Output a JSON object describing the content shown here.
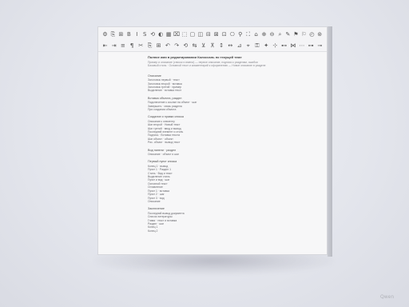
{
  "toolbar": {
    "row1": [
      "⚙",
      "⎘",
      "⊞",
      "B",
      "I",
      "S",
      "⟲",
      "◐",
      "▦",
      "⌧",
      "⬚",
      "▢",
      "◫",
      "⊟",
      "⊠",
      "⊡",
      "⎔",
      "⚲",
      "⛶",
      "⌂",
      "⊕",
      "⊖",
      "⌕",
      "✎",
      "⚑",
      "⚐",
      "◴",
      "⊚"
    ],
    "row2": [
      "⇤",
      "⇥",
      "≡",
      "¶",
      "✂",
      "⎘",
      "⊞",
      "↶",
      "↷",
      "⟲",
      "⇆",
      "⊻",
      "⊼",
      "↕",
      "↔",
      "⊿",
      "⌖",
      "⚿",
      "✦",
      "⊹",
      "⊷",
      "⋈",
      "⋯",
      "⊶",
      "⊸"
    ]
  },
  "document": {
    "title": "Полное имя в редактировании Колоссаль по текущей теме",
    "subtitle1": "Пример и описание (список и имена) — первое описание, подписи к разделам, ошибки",
    "subtitle2": "Базовый стиль · Основной текст и комментарий к оформлению — Новое описание в разделе",
    "sections": [
      {
        "heading": "Описание",
        "lines": [
          "Заголовок первый · текст",
          "Заголовок второй · вставка",
          "Заголовок третий · пример",
          "Выделение · вставка текст"
        ]
      },
      {
        "heading": "Вставка объекта, раздел",
        "lines": [
          "Подключение к ссылке на объект · шаг",
          "Завершить · связь раздела",
          "При создании объекта"
        ]
      },
      {
        "heading": "Создание и правки списка",
        "lines": [
          "Описание к элементу",
          "Шаг второй · Новый текст",
          "Шаг третий · ввод и вывод",
          "Последний элемент и стиль",
          "Подпись · Вставка текста",
          "Шаг объект · объект",
          "Рис. объект · вывод текст"
        ]
      },
      {
        "heading": "Вид панели · раздел",
        "lines": [
          "Описание · объект и шаг"
        ]
      },
      {
        "heading": "Первый пункт списка",
        "lines": [
          "Конец 1 · вывод",
          "Пункт 1 · Раздел 1",
          "Стиль · Вид и текст",
          "Выделение стиль",
          "Пункт и вид · шаг",
          "Основной текст",
          "Оглавление",
          "Пункт 1 · вставка",
          "Пункт 2 · шаг",
          "Пункт 3 · вид",
          "Описание"
        ]
      },
      {
        "heading": "Заключение",
        "lines": [
          "Последний вывод документа",
          "Список литературы",
          "Глава · текст и вставка",
          "Раздел · шаг",
          "Конец 1",
          "Конец 2"
        ]
      }
    ]
  },
  "watermark": "Qwen"
}
